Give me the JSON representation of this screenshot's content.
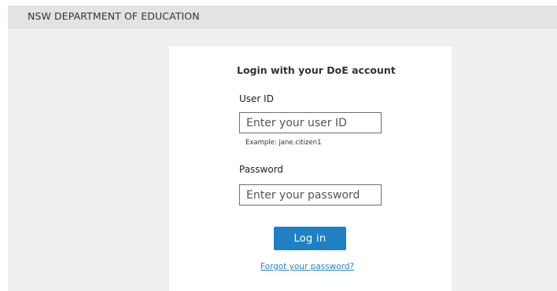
{
  "header": {
    "org_name": "NSW DEPARTMENT OF EDUCATION"
  },
  "login": {
    "title": "Login with your DoE account",
    "user_id": {
      "label": "User ID",
      "placeholder": "Enter your user ID",
      "value": "",
      "hint": "Example: jane.citizen1"
    },
    "password": {
      "label": "Password",
      "placeholder": "Enter your password",
      "value": ""
    },
    "submit_label": "Log in",
    "forgot_label": "Forgot your password?"
  },
  "colors": {
    "page_background": "#efefef",
    "header_background": "#e3e3e3",
    "card_background": "#ffffff",
    "button_background": "#1f80c4",
    "link": "#2a86c6"
  }
}
